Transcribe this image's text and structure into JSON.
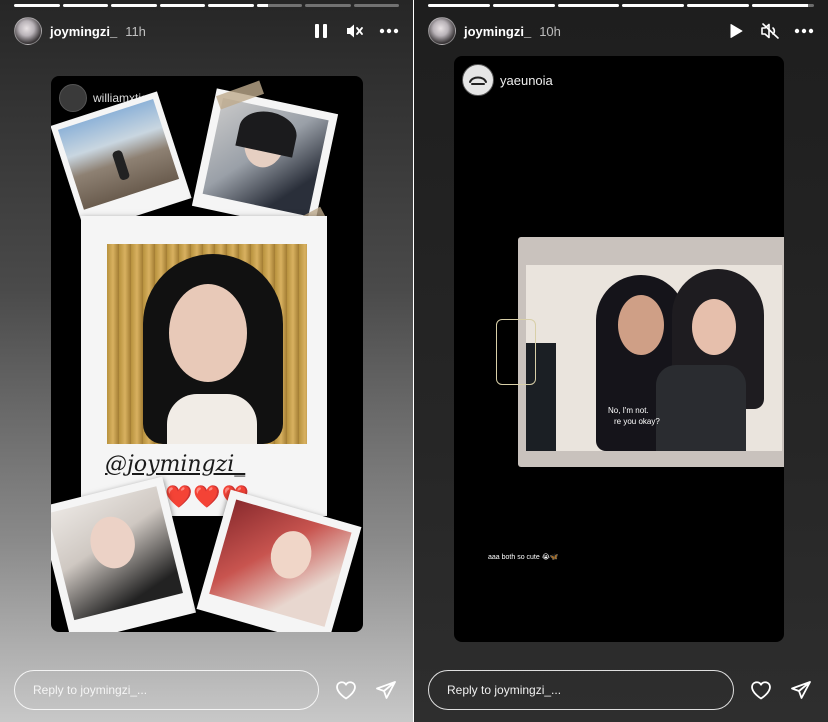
{
  "stories": [
    {
      "username": "joymingzi_",
      "time": "11h",
      "progress": [
        1,
        1,
        1,
        1,
        1,
        0.25,
        0,
        0
      ],
      "playback": "pause",
      "muted": true,
      "inner_username": "williamxtia",
      "mention": "@joymingzi_",
      "hearts": "❤️❤️❤️",
      "reply_placeholder": "Reply to joymingzi_..."
    },
    {
      "username": "joymingzi_",
      "time": "10h",
      "progress": [
        1,
        1,
        1,
        1,
        1,
        0.9
      ],
      "playback": "play",
      "muted": true,
      "inner_username": "yaeunoia",
      "subtitle_line1": "No, I'm not.",
      "subtitle_line2": "re you okay?",
      "caption": "aaa both so cute 😭🦋",
      "reply_placeholder": "Reply to joymingzi_..."
    }
  ],
  "icons": {
    "pause": "pause-icon",
    "play": "play-icon",
    "muted": "speaker-muted-icon",
    "more": "more-options-icon",
    "like": "heart-icon",
    "share": "send-icon"
  }
}
